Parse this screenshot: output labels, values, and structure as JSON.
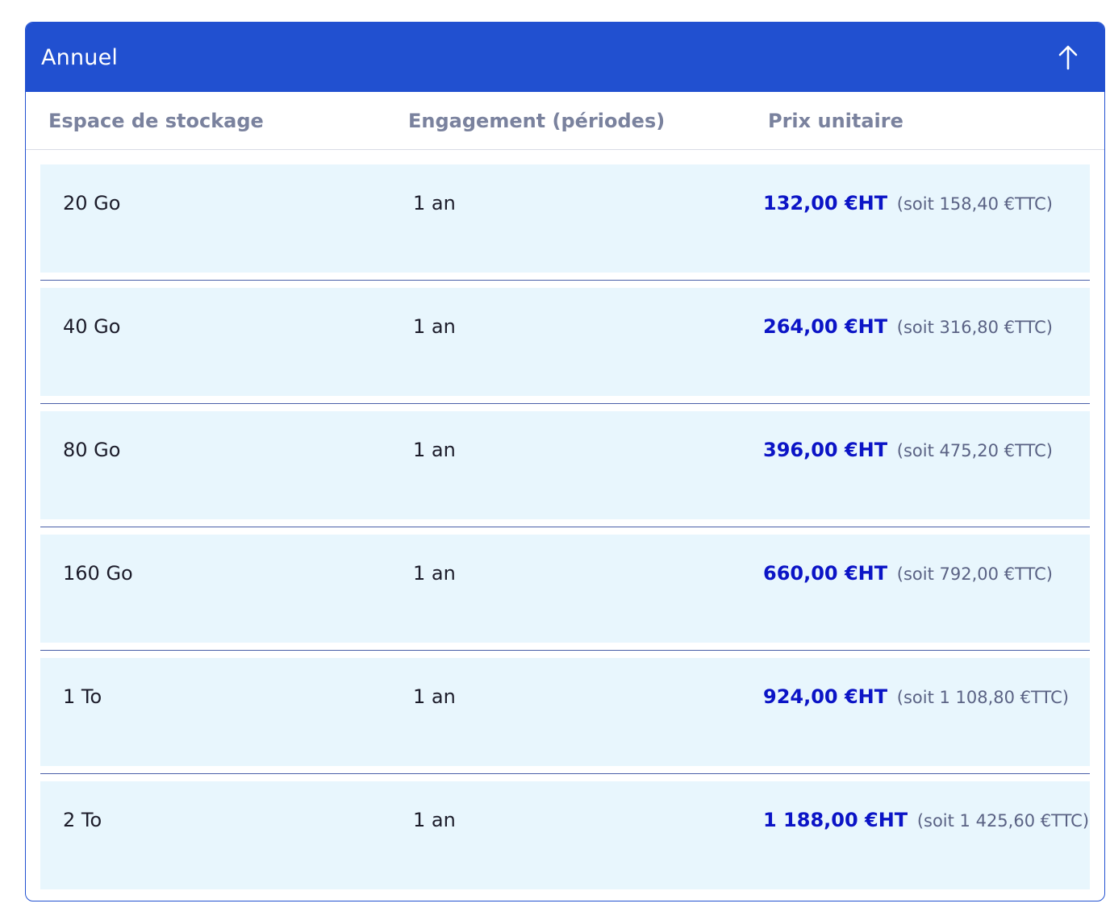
{
  "panel": {
    "title": "Annuel",
    "toggle_icon": "arrow-up-icon",
    "accent_color": "#2150d0"
  },
  "columns": {
    "storage": "Espace de stockage",
    "engagement": "Engagement (périodes)",
    "price": "Prix unitaire"
  },
  "rows": [
    {
      "storage": "20 Go",
      "engagement": "1 an",
      "price_ht": "132,00 €HT",
      "price_ttc": "(soit 158,40 €TTC)"
    },
    {
      "storage": "40 Go",
      "engagement": "1 an",
      "price_ht": "264,00 €HT",
      "price_ttc": "(soit 316,80 €TTC)"
    },
    {
      "storage": "80 Go",
      "engagement": "1 an",
      "price_ht": "396,00 €HT",
      "price_ttc": "(soit 475,20 €TTC)"
    },
    {
      "storage": "160 Go",
      "engagement": "1 an",
      "price_ht": "660,00 €HT",
      "price_ttc": "(soit 792,00 €TTC)"
    },
    {
      "storage": "1 To",
      "engagement": "1 an",
      "price_ht": "924,00 €HT",
      "price_ttc": "(soit 1 108,80 €TTC)"
    },
    {
      "storage": "2 To",
      "engagement": "1 an",
      "price_ht": "1 188,00 €HT",
      "price_ttc": "(soit 1 425,60 €TTC)"
    }
  ]
}
